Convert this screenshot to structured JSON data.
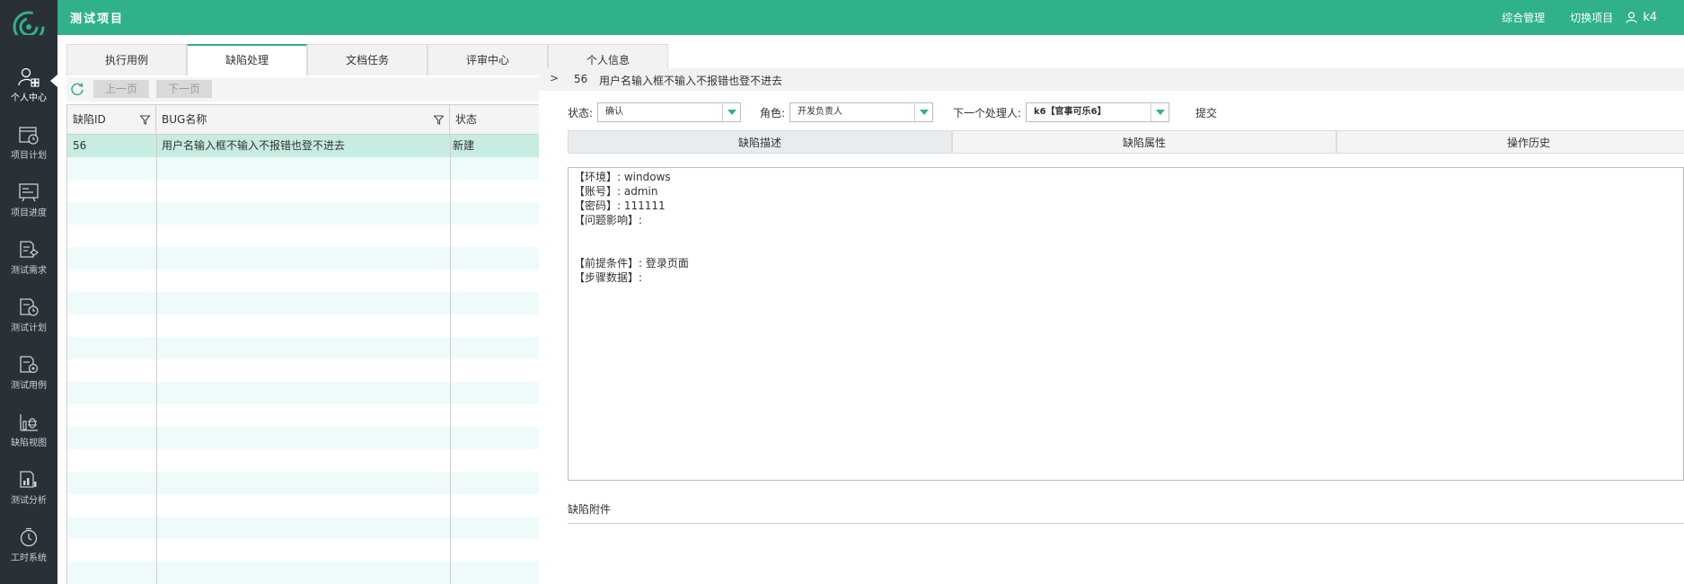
{
  "header": {
    "title": "测试项目",
    "nav": [
      "综合管理",
      "切换项目"
    ],
    "user": "k4"
  },
  "sidebar": {
    "items": [
      {
        "label": "个人中心",
        "icon": "user-grid-icon",
        "active": true
      },
      {
        "label": "项目计划",
        "icon": "calendar-clock-icon"
      },
      {
        "label": "项目进度",
        "icon": "progress-chart-icon"
      },
      {
        "label": "测试需求",
        "icon": "requirement-doc-icon"
      },
      {
        "label": "测试计划",
        "icon": "doc-clock-icon"
      },
      {
        "label": "测试用例",
        "icon": "doc-gear-icon"
      },
      {
        "label": "缺陷视图",
        "icon": "bug-view-icon"
      },
      {
        "label": "测试分析",
        "icon": "bar-analysis-icon"
      },
      {
        "label": "工时系统",
        "icon": "stopwatch-icon"
      }
    ]
  },
  "tabs": [
    {
      "label": "执行用例"
    },
    {
      "label": "缺陷处理",
      "active": true
    },
    {
      "label": "文档任务"
    },
    {
      "label": "评审中心"
    },
    {
      "label": "个人信息"
    }
  ],
  "list": {
    "prev_label": "上一页",
    "next_label": "下一页",
    "columns": [
      "缺陷ID",
      "BUG名称",
      "状态"
    ],
    "rows": [
      {
        "id": "56",
        "name": "用户名输入框不输入不报错也登不进去",
        "status": "新建"
      }
    ]
  },
  "detail": {
    "arrow": ">",
    "id": "56",
    "title": "用户名输入框不输入不报错也登不进去",
    "status_label": "状态:",
    "status_value": "确认",
    "role_label": "角色:",
    "role_value": "开发负责人",
    "next_handler_label": "下一个处理人:",
    "next_handler_value": "k6【官事可乐6】",
    "submit_label": "提交",
    "sub_tabs": [
      "缺陷描述",
      "缺陷属性",
      "操作历史"
    ],
    "description": {
      "l1": "【环境】: windows",
      "l2": "【账号】: admin",
      "l3": "【密码】: 111111",
      "l4": "【问题影响】:",
      "l5": "",
      "l6": "",
      "l7": "【前提条件】: 登录页面",
      "l8": "【步骤数据】:"
    },
    "attachments_label": "缺陷附件"
  },
  "colors": {
    "brand": "#30b18c",
    "sidebar": "#2a3038",
    "row_selected": "#c7ece1",
    "row_striped": "#effbfb"
  }
}
